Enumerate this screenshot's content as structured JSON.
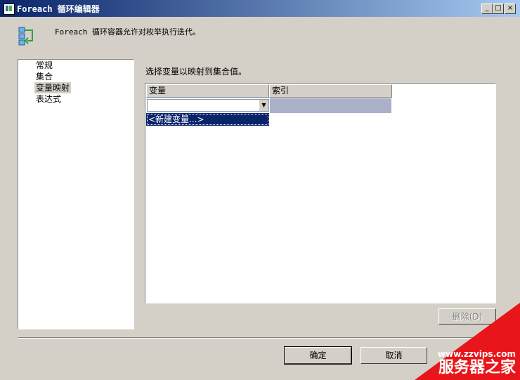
{
  "window": {
    "title": "Foreach 循环编辑器",
    "minimize": "_",
    "maximize": "□",
    "close": "×"
  },
  "header": {
    "description": "Foreach 循环容器允许对枚举执行迭代。",
    "icon": "foreach-loop-icon"
  },
  "nav": {
    "items": [
      {
        "label": "常规",
        "selected": false
      },
      {
        "label": "集合",
        "selected": false
      },
      {
        "label": "变量映射",
        "selected": true
      },
      {
        "label": "表达式",
        "selected": false
      }
    ]
  },
  "main": {
    "instruction": "选择变量以映射到集合值。",
    "grid": {
      "columns": [
        "变量",
        "索引"
      ],
      "combo_value": "",
      "dropdown_option": "<新建变量...>"
    }
  },
  "buttons": {
    "delete": "删除(D)",
    "ok": "确定",
    "cancel": "取消"
  },
  "watermark": {
    "url": "www.zzvips.com",
    "name": "服务器之家"
  },
  "colors": {
    "titlebar_start": "#0a246a",
    "titlebar_end": "#a6caf0",
    "selection": "#0a246a",
    "index_cell": "#aab0c8",
    "watermark": "#e8151b"
  }
}
